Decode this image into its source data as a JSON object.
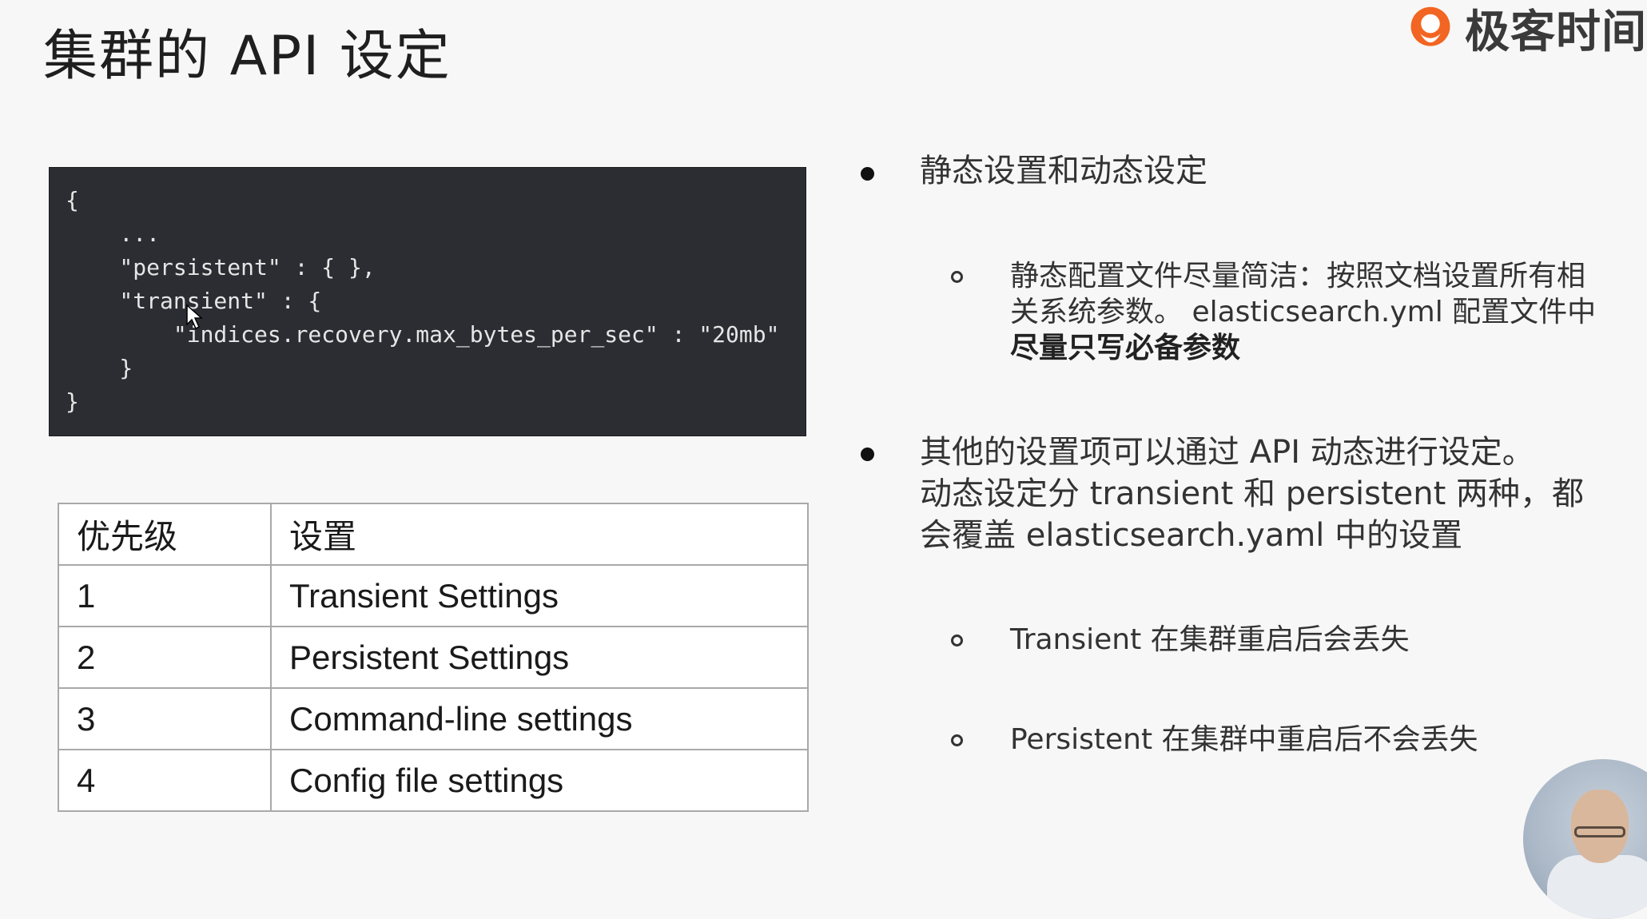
{
  "slide": {
    "title": "集群的 API 设定"
  },
  "brand": {
    "name": "极客时间",
    "logo_icon": "geektime-logo-icon",
    "logo_color": "#f26522"
  },
  "code": {
    "lines": [
      "{",
      "    ...",
      "    \"persistent\" : { },",
      "    \"transient\" : {",
      "        \"indices.recovery.max_bytes_per_sec\" : \"20mb\"",
      "    }",
      "}"
    ],
    "background": "#2b2d33"
  },
  "table": {
    "headers": [
      "优先级",
      "设置"
    ],
    "rows": [
      [
        "1",
        "Transient Settings"
      ],
      [
        "2",
        "Persistent Settings"
      ],
      [
        "3",
        "Command-line settings"
      ],
      [
        "4",
        "Config file settings"
      ]
    ]
  },
  "bullets": {
    "b1": {
      "text": "静态设置和动态设定",
      "sub": {
        "line1": "静态配置文件尽量简洁：按照文档设置所有相",
        "line2": "关系统参数。 elasticsearch.yml 配置文件中",
        "line3_bold": "尽量只写必备参数"
      }
    },
    "b2": {
      "line1": "其他的设置项可以通过 API 动态进行设定。",
      "line2": "动态设定分 transient 和 persistent 两种，都",
      "line3": "会覆盖 elasticsearch.yaml 中的设置",
      "sub1": "Transient 在集群重启后会丢失",
      "sub2": "Persistent 在集群中重启后不会丢失"
    }
  }
}
